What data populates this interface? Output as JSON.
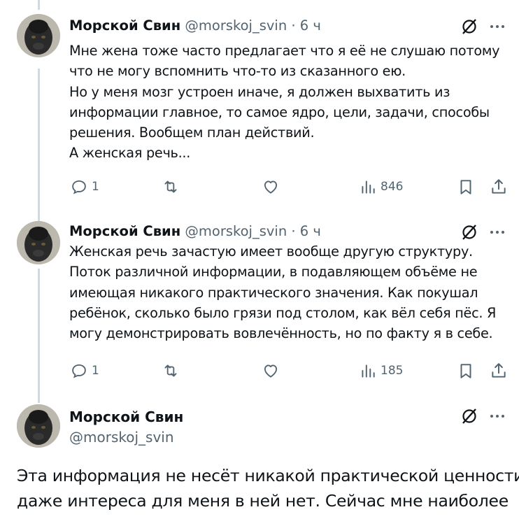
{
  "tweets": [
    {
      "author_name": "Морской Свин",
      "handle": "@morskoj_svin",
      "separator": "·",
      "time": "6 ч",
      "lines": [
        "Мне жена тоже часто предлагает что я её не слушаю потому",
        "что не могу вспомнить что-то из сказанного ею.",
        "Но у меня мозг устроен иначе, я должен выхватить из",
        "информации главное, то самое ядро, цели, задачи, способы",
        "решения. Вообщем план действий.",
        "А женская речь..."
      ],
      "replies": "1",
      "views": "846"
    },
    {
      "author_name": "Морской Свин",
      "handle": "@morskoj_svin",
      "separator": "·",
      "time": "6 ч",
      "lines": [
        "Женская речь зачастую имеет вообще другую структуру.",
        "Поток различной информации, в подавляющем объёме не",
        "имеющая никакого практического значения. Как покушал",
        "ребёнок, сколько было грязи под столом, как вёл себя пёс. Я",
        "могу демонстрировать вовлечённость, но по факту я в себе."
      ],
      "replies": "1",
      "views": "185"
    }
  ],
  "focused_tweet": {
    "author_name": "Морской Свин",
    "handle": "@morskoj_svin",
    "lines": [
      "Эта информация не несёт никакой практической ценности,",
      "даже интереса для меня в ней нет. Сейчас мне наиболее"
    ]
  },
  "icons": {
    "grok": "grok-slash-icon",
    "more": "more-dots-icon",
    "reply": "reply-bubble-icon",
    "repost": "repost-arrows-icon",
    "like": "heart-icon",
    "views": "views-bars-icon",
    "bookmark": "bookmark-icon",
    "share": "share-upload-icon"
  },
  "colors": {
    "text": "#0f1419",
    "secondary": "#536471",
    "thread_line": "#cfd9de"
  }
}
